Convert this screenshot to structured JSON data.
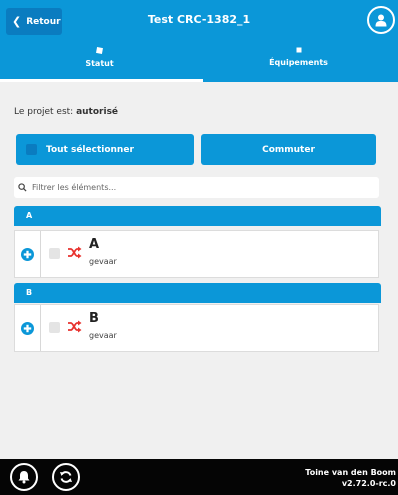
{
  "header": {
    "back_label": "Retour",
    "title": "Test CRC-1382_1"
  },
  "tabs": [
    {
      "label": "Statut",
      "icon": "square-icon",
      "active": true
    },
    {
      "label": "Équipements",
      "icon": "square-icon",
      "active": false
    }
  ],
  "status": {
    "prefix": "Le projet est:",
    "value": "autorisé"
  },
  "actions": {
    "select_all_label": "Tout sélectionner",
    "switch_label": "Commuter"
  },
  "filter": {
    "placeholder": "Filtrer les éléments..."
  },
  "groups": [
    {
      "header": "A",
      "items": [
        {
          "name": "A",
          "subtitle": "gevaar"
        }
      ]
    },
    {
      "header": "B",
      "items": [
        {
          "name": "B",
          "subtitle": "gevaar"
        }
      ]
    }
  ],
  "footer": {
    "user_name": "Toine van den Boom",
    "version": "v2.72.0-rc.0"
  },
  "colors": {
    "accent": "#0b97d8",
    "accent_dark": "#0a7cc0",
    "footer": "#050505",
    "shuffle_icon": "#e8322e"
  }
}
